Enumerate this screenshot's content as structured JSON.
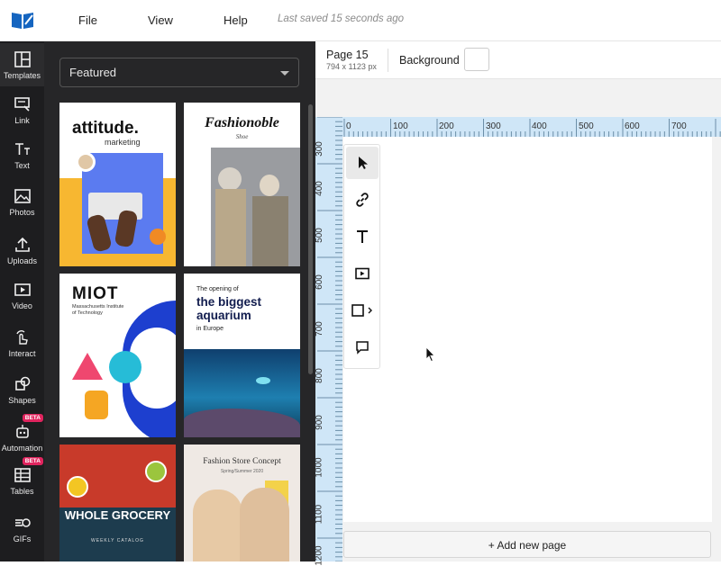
{
  "topbar": {
    "menu": [
      "File",
      "View",
      "Help"
    ],
    "saved_status": "Last saved 15 seconds ago"
  },
  "rail": {
    "items": [
      {
        "label": "Templates",
        "icon": "templates-icon"
      },
      {
        "label": "Link",
        "icon": "link-icon"
      },
      {
        "label": "Text",
        "icon": "text-icon"
      },
      {
        "label": "Photos",
        "icon": "photos-icon"
      },
      {
        "label": "Uploads",
        "icon": "uploads-icon"
      },
      {
        "label": "Video",
        "icon": "video-icon"
      },
      {
        "label": "Interact",
        "icon": "interact-icon"
      },
      {
        "label": "Shapes",
        "icon": "shapes-icon"
      },
      {
        "label": "Automation",
        "icon": "automation-icon",
        "badge": "BETA"
      },
      {
        "label": "Tables",
        "icon": "tables-icon",
        "badge": "BETA"
      },
      {
        "label": "GIFs",
        "icon": "gifs-icon"
      }
    ]
  },
  "panel": {
    "category": "Featured",
    "templates": [
      {
        "title": "attitude.",
        "subtitle": "marketing"
      },
      {
        "title": "Fashionoble",
        "subtitle": "Shoe"
      },
      {
        "title": "MIOT",
        "subtitle": "Massachusetts Institute of Technology"
      },
      {
        "title": "the biggest aquarium",
        "subtitle": "The opening of",
        "extra": "in Europe"
      },
      {
        "title": "WHOLE GROCERY",
        "subtitle": "WEEKLY CATALOG"
      },
      {
        "title": "Fashion Store Concept",
        "subtitle": "Spring/Summer 2020"
      }
    ]
  },
  "page_props": {
    "name": "Page 15",
    "size": "794 x 1123 px",
    "background_label": "Background",
    "background_color": "#ffffff"
  },
  "rulers": {
    "top": [
      "0",
      "100",
      "200",
      "300",
      "400",
      "500",
      "600",
      "700"
    ],
    "left": [
      "300",
      "400",
      "500",
      "600",
      "700",
      "800",
      "900",
      "1000",
      "1100",
      "1200"
    ]
  },
  "add_page_label": "+ Add new page",
  "colors": {
    "accent": "#1565c0",
    "rail": "#1d1d1f",
    "panel": "#262628",
    "ruler": "#cfe6f7"
  }
}
